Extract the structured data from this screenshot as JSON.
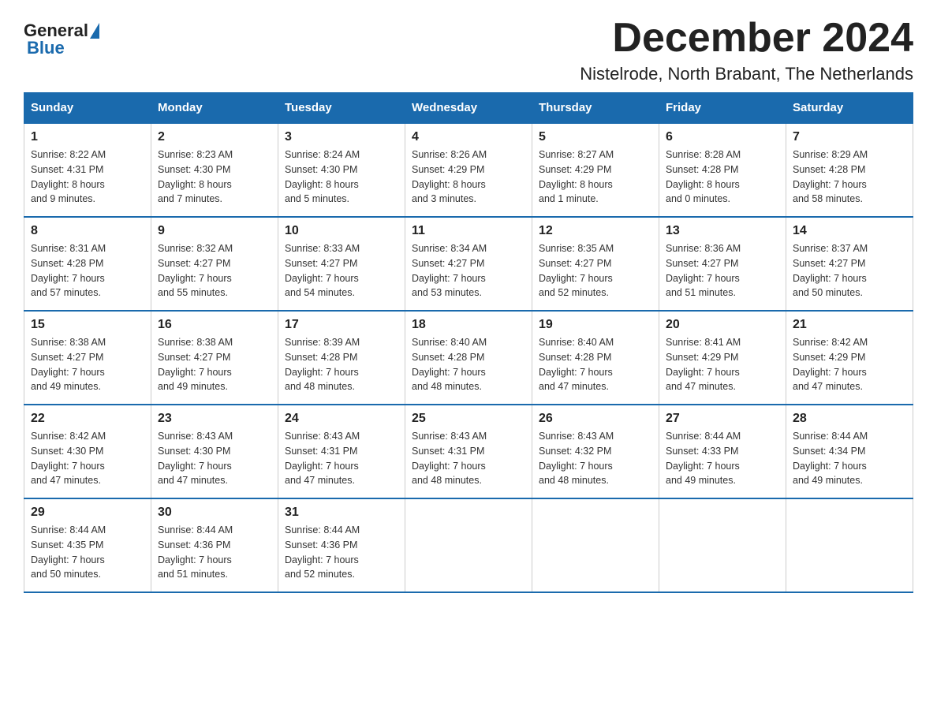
{
  "header": {
    "logo_general": "General",
    "logo_blue": "Blue",
    "month_title": "December 2024",
    "location": "Nistelrode, North Brabant, The Netherlands"
  },
  "days_of_week": [
    "Sunday",
    "Monday",
    "Tuesday",
    "Wednesday",
    "Thursday",
    "Friday",
    "Saturday"
  ],
  "weeks": [
    [
      {
        "day": "1",
        "sunrise": "8:22 AM",
        "sunset": "4:31 PM",
        "daylight": "8 hours and 9 minutes."
      },
      {
        "day": "2",
        "sunrise": "8:23 AM",
        "sunset": "4:30 PM",
        "daylight": "8 hours and 7 minutes."
      },
      {
        "day": "3",
        "sunrise": "8:24 AM",
        "sunset": "4:30 PM",
        "daylight": "8 hours and 5 minutes."
      },
      {
        "day": "4",
        "sunrise": "8:26 AM",
        "sunset": "4:29 PM",
        "daylight": "8 hours and 3 minutes."
      },
      {
        "day": "5",
        "sunrise": "8:27 AM",
        "sunset": "4:29 PM",
        "daylight": "8 hours and 1 minute."
      },
      {
        "day": "6",
        "sunrise": "8:28 AM",
        "sunset": "4:28 PM",
        "daylight": "8 hours and 0 minutes."
      },
      {
        "day": "7",
        "sunrise": "8:29 AM",
        "sunset": "4:28 PM",
        "daylight": "7 hours and 58 minutes."
      }
    ],
    [
      {
        "day": "8",
        "sunrise": "8:31 AM",
        "sunset": "4:28 PM",
        "daylight": "7 hours and 57 minutes."
      },
      {
        "day": "9",
        "sunrise": "8:32 AM",
        "sunset": "4:27 PM",
        "daylight": "7 hours and 55 minutes."
      },
      {
        "day": "10",
        "sunrise": "8:33 AM",
        "sunset": "4:27 PM",
        "daylight": "7 hours and 54 minutes."
      },
      {
        "day": "11",
        "sunrise": "8:34 AM",
        "sunset": "4:27 PM",
        "daylight": "7 hours and 53 minutes."
      },
      {
        "day": "12",
        "sunrise": "8:35 AM",
        "sunset": "4:27 PM",
        "daylight": "7 hours and 52 minutes."
      },
      {
        "day": "13",
        "sunrise": "8:36 AM",
        "sunset": "4:27 PM",
        "daylight": "7 hours and 51 minutes."
      },
      {
        "day": "14",
        "sunrise": "8:37 AM",
        "sunset": "4:27 PM",
        "daylight": "7 hours and 50 minutes."
      }
    ],
    [
      {
        "day": "15",
        "sunrise": "8:38 AM",
        "sunset": "4:27 PM",
        "daylight": "7 hours and 49 minutes."
      },
      {
        "day": "16",
        "sunrise": "8:38 AM",
        "sunset": "4:27 PM",
        "daylight": "7 hours and 49 minutes."
      },
      {
        "day": "17",
        "sunrise": "8:39 AM",
        "sunset": "4:28 PM",
        "daylight": "7 hours and 48 minutes."
      },
      {
        "day": "18",
        "sunrise": "8:40 AM",
        "sunset": "4:28 PM",
        "daylight": "7 hours and 48 minutes."
      },
      {
        "day": "19",
        "sunrise": "8:40 AM",
        "sunset": "4:28 PM",
        "daylight": "7 hours and 47 minutes."
      },
      {
        "day": "20",
        "sunrise": "8:41 AM",
        "sunset": "4:29 PM",
        "daylight": "7 hours and 47 minutes."
      },
      {
        "day": "21",
        "sunrise": "8:42 AM",
        "sunset": "4:29 PM",
        "daylight": "7 hours and 47 minutes."
      }
    ],
    [
      {
        "day": "22",
        "sunrise": "8:42 AM",
        "sunset": "4:30 PM",
        "daylight": "7 hours and 47 minutes."
      },
      {
        "day": "23",
        "sunrise": "8:43 AM",
        "sunset": "4:30 PM",
        "daylight": "7 hours and 47 minutes."
      },
      {
        "day": "24",
        "sunrise": "8:43 AM",
        "sunset": "4:31 PM",
        "daylight": "7 hours and 47 minutes."
      },
      {
        "day": "25",
        "sunrise": "8:43 AM",
        "sunset": "4:31 PM",
        "daylight": "7 hours and 48 minutes."
      },
      {
        "day": "26",
        "sunrise": "8:43 AM",
        "sunset": "4:32 PM",
        "daylight": "7 hours and 48 minutes."
      },
      {
        "day": "27",
        "sunrise": "8:44 AM",
        "sunset": "4:33 PM",
        "daylight": "7 hours and 49 minutes."
      },
      {
        "day": "28",
        "sunrise": "8:44 AM",
        "sunset": "4:34 PM",
        "daylight": "7 hours and 49 minutes."
      }
    ],
    [
      {
        "day": "29",
        "sunrise": "8:44 AM",
        "sunset": "4:35 PM",
        "daylight": "7 hours and 50 minutes."
      },
      {
        "day": "30",
        "sunrise": "8:44 AM",
        "sunset": "4:36 PM",
        "daylight": "7 hours and 51 minutes."
      },
      {
        "day": "31",
        "sunrise": "8:44 AM",
        "sunset": "4:36 PM",
        "daylight": "7 hours and 52 minutes."
      },
      null,
      null,
      null,
      null
    ]
  ],
  "labels": {
    "sunrise": "Sunrise:",
    "sunset": "Sunset:",
    "daylight": "Daylight:"
  }
}
